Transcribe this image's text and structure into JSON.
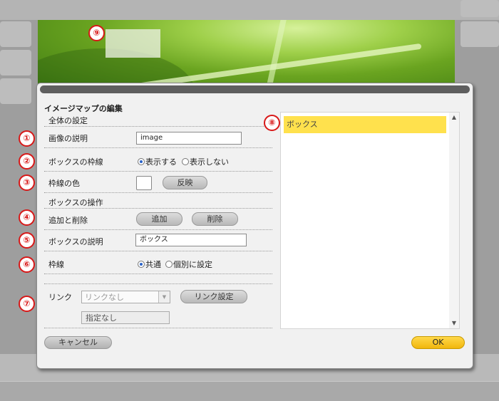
{
  "dialog": {
    "title": "イメージマップの編集",
    "section_global": "全体の設定",
    "section_box": "ボックスの操作",
    "image_description": {
      "label": "画像の説明",
      "value": "image"
    },
    "box_border": {
      "label": "ボックスの枠線",
      "option_show": "表示する",
      "option_hide": "表示しない",
      "selected": "表示する"
    },
    "border_color": {
      "label": "枠線の色",
      "apply_label": "反映",
      "color": "#ffffff"
    },
    "add_remove": {
      "label": "追加と削除",
      "add_label": "追加",
      "remove_label": "削除"
    },
    "box_description": {
      "label": "ボックスの説明",
      "value": "ボックス"
    },
    "border": {
      "label": "枠線",
      "option_common": "共通",
      "option_individual": "個別に設定",
      "selected": "共通"
    },
    "link": {
      "label": "リンク",
      "select_value": "リンクなし",
      "settings_label": "リンク設定",
      "target_value": "指定なし"
    },
    "box_list": [
      {
        "label": "ボックス",
        "selected": true
      }
    ],
    "cancel_label": "キャンセル",
    "ok_label": "OK"
  },
  "callouts": [
    "①",
    "②",
    "③",
    "④",
    "⑤",
    "⑥",
    "⑦",
    "⑧",
    "⑨"
  ],
  "colors": {
    "accent_yellow": "#ffe14d",
    "ok_button": "#f5c518",
    "callout_red": "#d81818"
  }
}
